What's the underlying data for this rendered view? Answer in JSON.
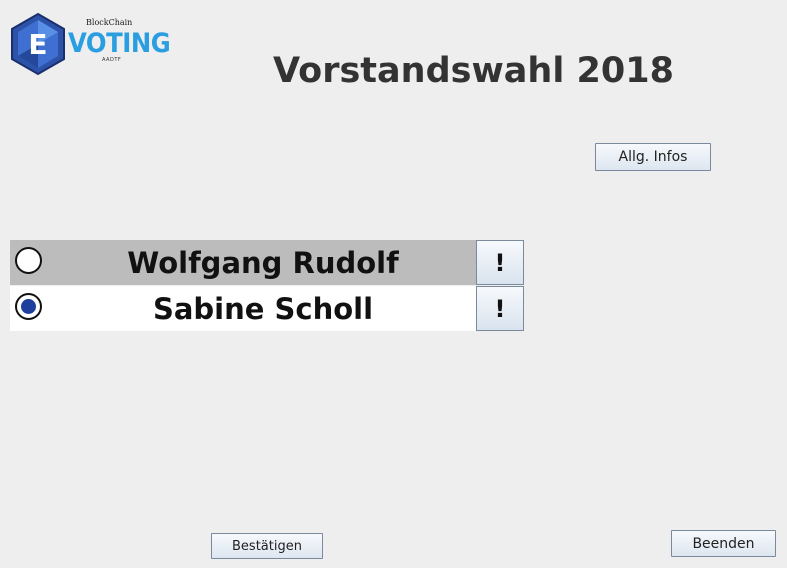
{
  "logo": {
    "letter": "E",
    "blockchain_text": "BlockChain",
    "word": "VOTING",
    "sub_text": "AADTF"
  },
  "title": "Vorstandswahl 2018",
  "buttons": {
    "infos_label": "Allg. Infos",
    "confirm_label": "Bestätigen",
    "end_label": "Beenden"
  },
  "candidates": [
    {
      "name": "Wolfgang Rudolf",
      "selected": false,
      "info_label": "!"
    },
    {
      "name": "Sabine Scholl",
      "selected": true,
      "info_label": "!"
    }
  ],
  "colors": {
    "background": "#eeeeee",
    "row_highlight": "#bcbcbc",
    "radio_selected": "#1f3f9e",
    "logo_blue": "#2a9ee0",
    "logo_hex": "#2d53a8"
  }
}
